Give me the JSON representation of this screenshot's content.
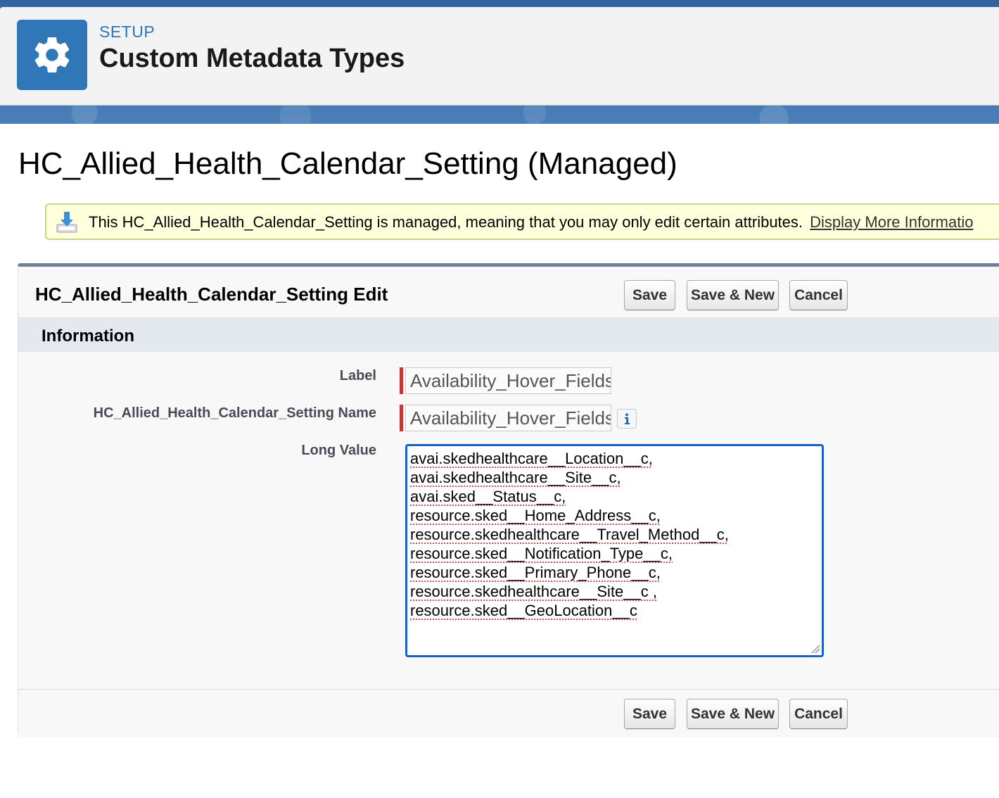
{
  "header": {
    "kicker": "SETUP",
    "title": "Custom Metadata Types",
    "icon": "gear-icon"
  },
  "page": {
    "title": "HC_Allied_Health_Calendar_Setting (Managed)"
  },
  "banner": {
    "text": "This HC_Allied_Health_Calendar_Setting is managed, meaning that you may only edit certain attributes.",
    "link": "Display More Informatio",
    "icon": "download-tray-icon"
  },
  "edit": {
    "title": "HC_Allied_Health_Calendar_Setting Edit",
    "buttons": {
      "save": "Save",
      "save_new": "Save & New",
      "cancel": "Cancel"
    },
    "section_title": "Information",
    "fields": {
      "label": {
        "name": "Label",
        "value": "Availability_Hover_Fields"
      },
      "setting_name": {
        "name": "HC_Allied_Health_Calendar_Setting Name",
        "value": "Availability_Hover_Fields"
      },
      "long_value": {
        "name": "Long Value",
        "lines": [
          "avai.skedhealthcare__Location__c,",
          "avai.skedhealthcare__Site__c,",
          "avai.sked__Status__c,",
          "resource.sked__Home_Address__c,",
          "resource.skedhealthcare__Travel_Method__c,",
          "resource.sked__Notification_Type__c,",
          "resource.sked__Primary_Phone__c,",
          "resource.skedhealthcare__Site__c ,",
          "resource.sked__GeoLocation__c"
        ]
      }
    }
  },
  "colors": {
    "accent": "#2f77b6",
    "required": "#c23934",
    "focus": "#1a62c4",
    "banner_bg": "#ffffdc"
  }
}
